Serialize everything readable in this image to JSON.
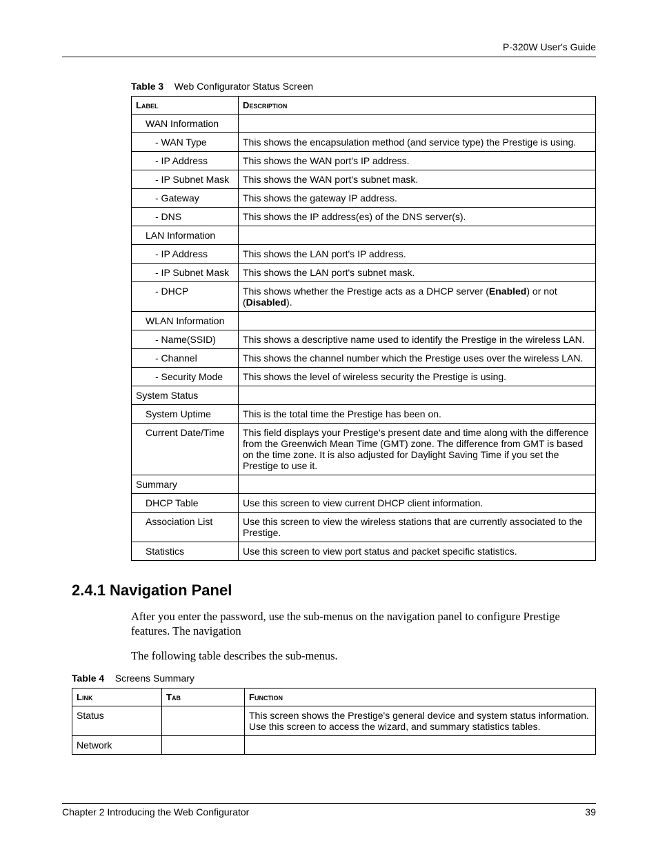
{
  "header": {
    "running_title": "P-320W User's Guide"
  },
  "table3": {
    "caption_prefix": "Table 3",
    "caption_text": "Web Configurator Status Screen",
    "head_label": "Label",
    "head_desc": "Description",
    "rows": [
      {
        "indent": 1,
        "label": "WAN Information",
        "desc": ""
      },
      {
        "indent": 2,
        "label": "- WAN Type",
        "desc": "This shows the encapsulation method (and service type) the Prestige is using."
      },
      {
        "indent": 2,
        "label": "- IP Address",
        "desc": "This shows the WAN port's IP address."
      },
      {
        "indent": 2,
        "label": "- IP Subnet Mask",
        "desc": "This shows the WAN port's subnet mask."
      },
      {
        "indent": 2,
        "label": "- Gateway",
        "desc": "This shows the gateway IP address."
      },
      {
        "indent": 2,
        "label": "- DNS",
        "desc": "This shows the IP address(es) of the DNS server(s)."
      },
      {
        "indent": 1,
        "label": "LAN Information",
        "desc": ""
      },
      {
        "indent": 2,
        "label": "- IP Address",
        "desc": "This shows the LAN port's IP address."
      },
      {
        "indent": 2,
        "label": "- IP Subnet Mask",
        "desc": "This shows the LAN port's subnet mask."
      },
      {
        "indent": 2,
        "label": "- DHCP",
        "desc_html": "This shows whether the Prestige acts as a DHCP server (<b>Enabled</b>) or not (<b>Disabled</b>)."
      },
      {
        "indent": 1,
        "label": "WLAN Information",
        "desc": ""
      },
      {
        "indent": 2,
        "label": "- Name(SSID)",
        "desc": "This shows a descriptive name used to identify the Prestige in the wireless LAN."
      },
      {
        "indent": 2,
        "label": "- Channel",
        "desc": "This shows the channel number which the Prestige uses over the wireless LAN."
      },
      {
        "indent": 2,
        "label": "- Security Mode",
        "desc": "This shows the level of wireless security the Prestige is using."
      },
      {
        "indent": 0,
        "label": "System Status",
        "desc": ""
      },
      {
        "indent": 1,
        "label": "System Uptime",
        "desc": "This is the total time the Prestige has been on."
      },
      {
        "indent": 1,
        "label": "Current Date/Time",
        "desc": "This field displays your Prestige's present date and time along with the difference from the Greenwich Mean Time (GMT) zone. The difference from GMT is based on the time zone. It is also adjusted for Daylight Saving Time if you set the Prestige to use it."
      },
      {
        "indent": 0,
        "label": "Summary",
        "desc": ""
      },
      {
        "indent": 1,
        "label": "DHCP Table",
        "desc": "Use this screen to view current DHCP client information."
      },
      {
        "indent": 1,
        "label": "Association List",
        "desc": "Use this screen to view the wireless stations that are currently associated to the Prestige."
      },
      {
        "indent": 1,
        "label": "Statistics",
        "desc": "Use this screen to view port status and packet specific statistics."
      }
    ]
  },
  "section": {
    "heading": "2.4.1  Navigation Panel",
    "para1": "After you enter the password, use the sub-menus on the navigation panel to configure Prestige features. The navigation",
    "para2": "The following table describes the sub-menus."
  },
  "table4": {
    "caption_prefix": "Table 4",
    "caption_text": "Screens Summary",
    "head_link": "Link",
    "head_tab": "Tab",
    "head_func": "Function",
    "rows": [
      {
        "link": "Status",
        "tab": "",
        "func": "This screen shows the Prestige's general device and system status information. Use this screen to access the wizard, and summary statistics tables."
      },
      {
        "link": "Network",
        "tab": "",
        "func": ""
      }
    ]
  },
  "footer": {
    "chapter": "Chapter 2 Introducing the Web Configurator",
    "page": "39"
  }
}
